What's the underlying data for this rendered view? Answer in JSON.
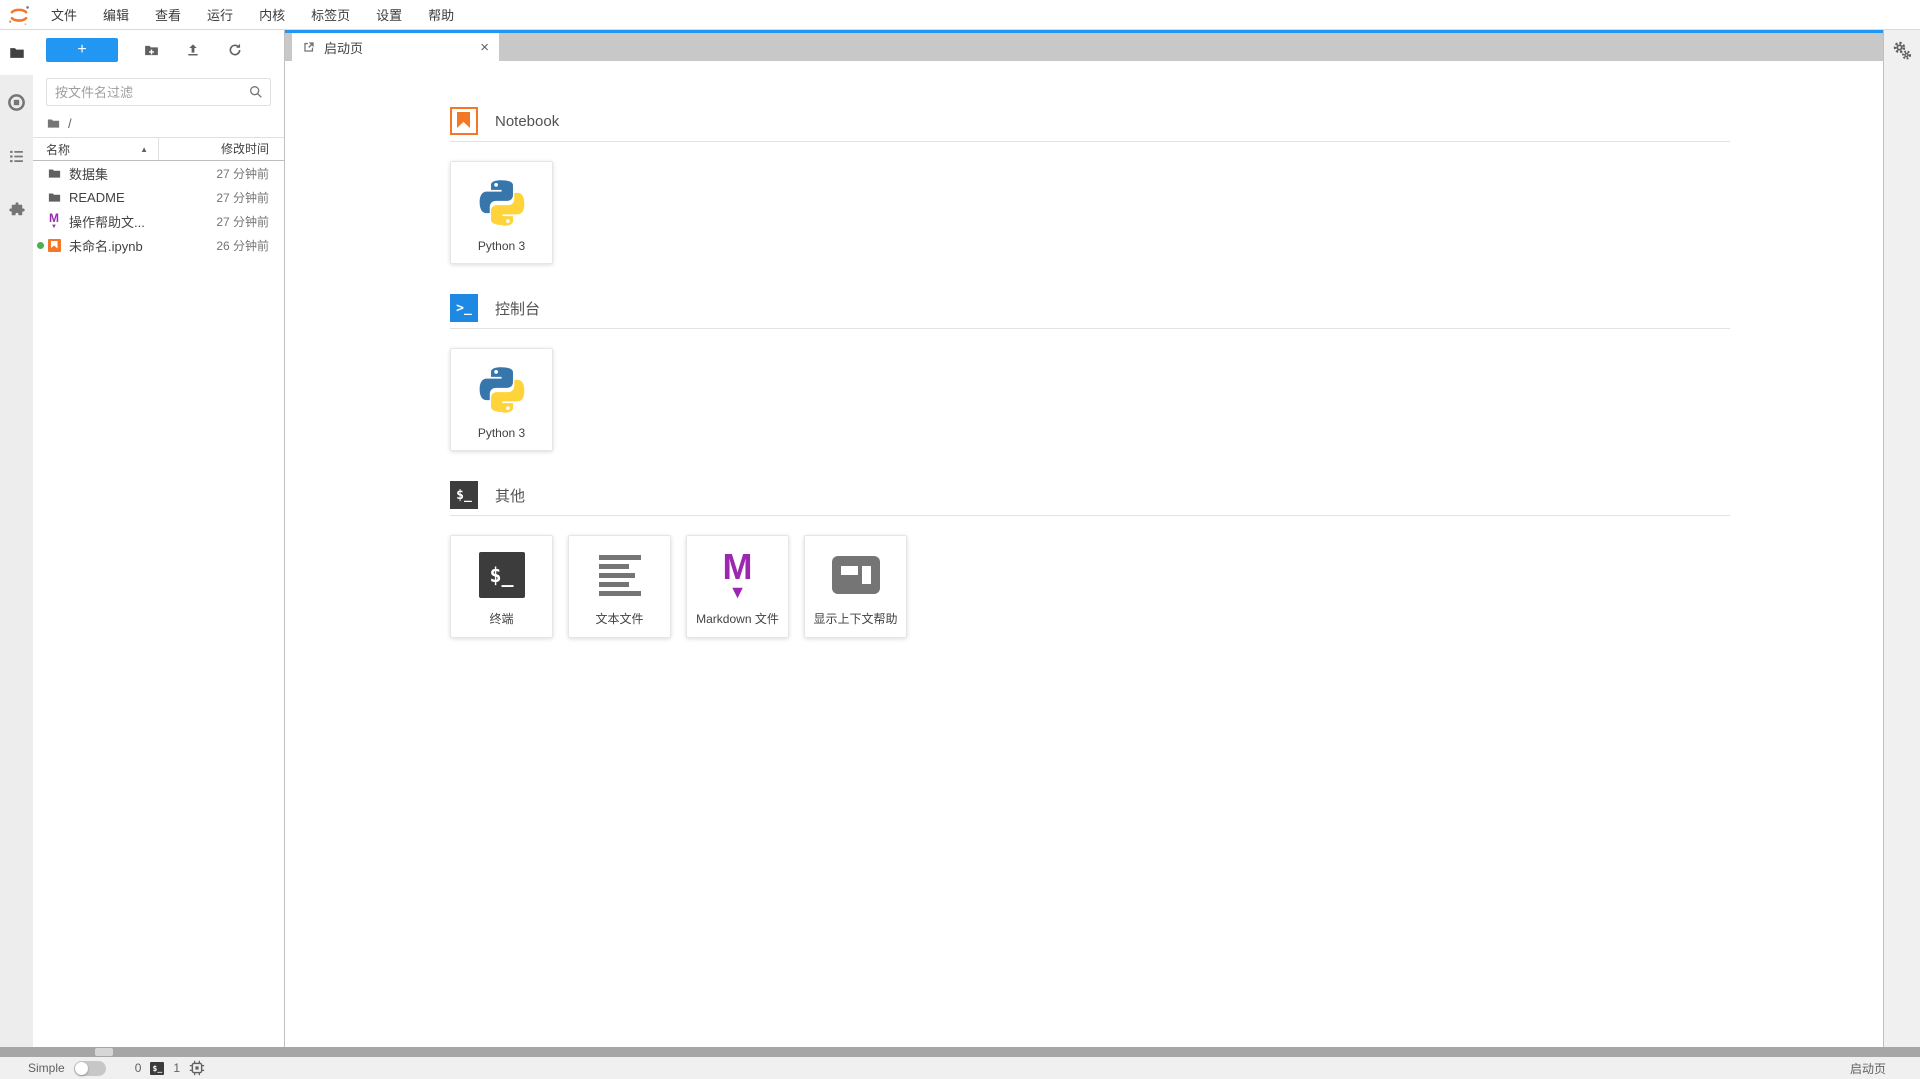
{
  "menu_bar": {
    "logo_icon": "jupyter-logo",
    "items": [
      "文件",
      "编辑",
      "查看",
      "运行",
      "内核",
      "标签页",
      "设置",
      "帮助"
    ]
  },
  "activity_bar": {
    "items": [
      {
        "icon": "folder-icon",
        "state": "active"
      },
      {
        "icon": "running-kernels-icon",
        "state": "inactive"
      },
      {
        "icon": "table-of-contents-icon",
        "state": "inactive"
      },
      {
        "icon": "extensions-icon",
        "state": "inactive"
      }
    ]
  },
  "file_browser": {
    "new_launcher_button_label": "+",
    "toolbar_icons": [
      "new-folder-icon",
      "upload-icon",
      "refresh-icon"
    ],
    "filter_placeholder": "按文件名过滤",
    "breadcrumb_root": "/",
    "columns": {
      "name": "名称",
      "modified": "修改时间"
    },
    "sort_indicator": "▲",
    "files": [
      {
        "name": "数据集",
        "modified": "27 分钟前",
        "type": "folder"
      },
      {
        "name": "README",
        "modified": "27 分钟前",
        "type": "folder"
      },
      {
        "name": "操作帮助文...",
        "modified": "27 分钟前",
        "type": "markdown"
      },
      {
        "name": "未命名.ipynb",
        "modified": "26 分钟前",
        "type": "notebook",
        "kernel_running": true
      }
    ]
  },
  "main_area": {
    "tab": {
      "icon": "launcher-icon",
      "label": "启动页",
      "close_label": "×"
    },
    "launcher": {
      "sections": [
        {
          "title": "Notebook",
          "icon": "notebook-icon",
          "cards": [
            {
              "label": "Python 3",
              "icon": "python-logo-icon"
            }
          ]
        },
        {
          "title": "控制台",
          "icon": "console-icon",
          "cards": [
            {
              "label": "Python 3",
              "icon": "python-logo-icon"
            }
          ]
        },
        {
          "title": "其他",
          "icon": "terminal-icon",
          "cards": [
            {
              "label": "终端",
              "icon": "terminal-icon"
            },
            {
              "label": "文本文件",
              "icon": "text-file-icon"
            },
            {
              "label": "Markdown 文件",
              "icon": "markdown-icon"
            },
            {
              "label": "显示上下文帮助",
              "icon": "context-help-icon"
            }
          ]
        }
      ]
    }
  },
  "right_bar": {
    "icon": "settings-gears-icon"
  },
  "status_bar": {
    "mode_label": "Simple",
    "terminals_count": "0",
    "kernels_count": "1",
    "current_tab_label": "启动页"
  },
  "glyphs": {
    "console_prompt": ">_",
    "terminal_prompt": "$_",
    "markdown_letter": "M",
    "markdown_arrow": "▼"
  },
  "colors": {
    "accent_blue": "#2196f3",
    "jupyter_orange": "#f37726",
    "markdown_purple": "#9c27b0",
    "running_green": "#4caf50",
    "console_blue": "#1e88e5"
  }
}
